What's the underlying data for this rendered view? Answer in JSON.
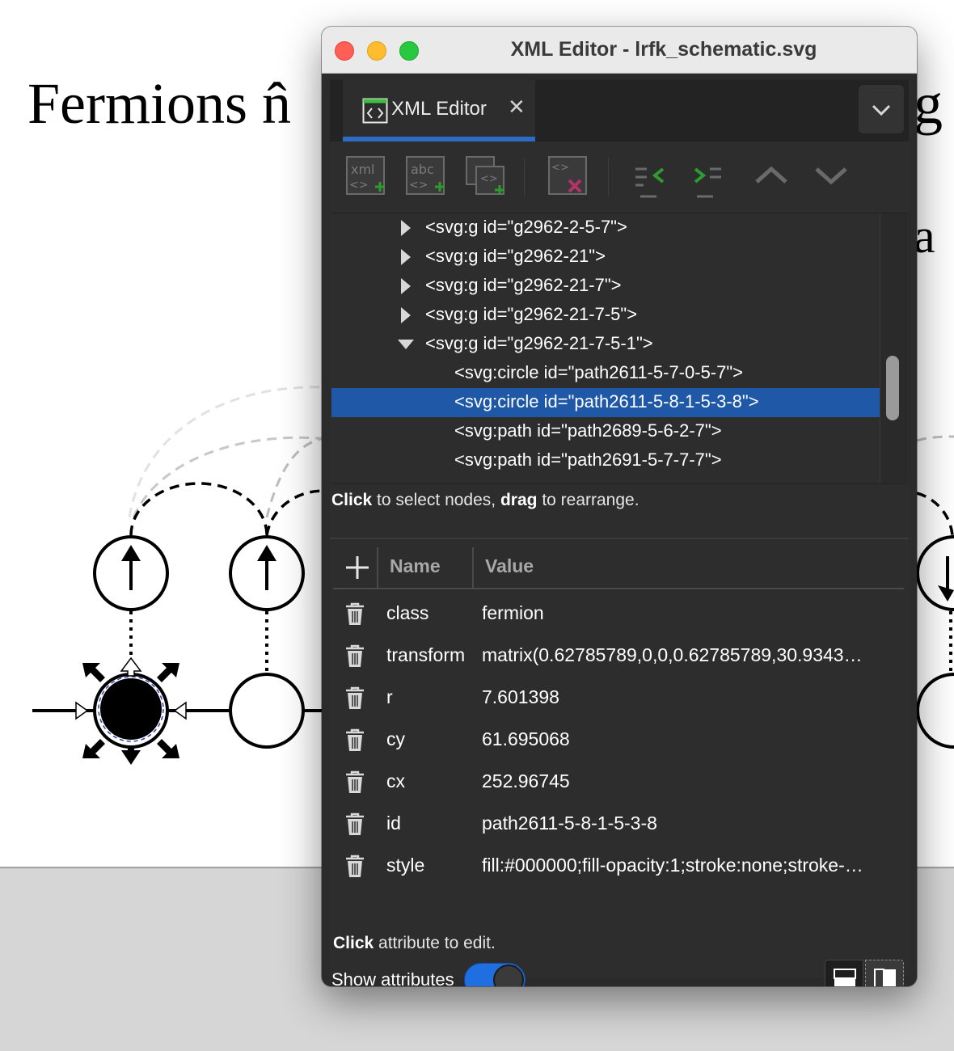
{
  "canvas": {
    "heading_left": "Fermions n̂",
    "heading_right": "g",
    "heading_right2": "a"
  },
  "window": {
    "title": "XML Editor - lrfk_schematic.svg"
  },
  "tab": {
    "label": "XML Editor",
    "close_glyph": "✕",
    "menu_icon": "chevron-down-icon"
  },
  "toolbar": {
    "new_element_icon": "xml-new-element-icon",
    "new_text_icon": "abc-new-text-node-icon",
    "duplicate_icon": "duplicate-node-icon",
    "delete_icon": "delete-node-icon",
    "unindent_icon": "unindent-node-icon",
    "indent_icon": "indent-node-icon",
    "raise_icon": "raise-node-icon",
    "lower_icon": "lower-node-icon"
  },
  "tree": {
    "nodes": [
      {
        "text": "<svg:g id=\"g2962-2-5-7\">",
        "expander": "collapsed"
      },
      {
        "text": "<svg:g id=\"g2962-21\">",
        "expander": "collapsed"
      },
      {
        "text": "<svg:g id=\"g2962-21-7\">",
        "expander": "collapsed"
      },
      {
        "text": "<svg:g id=\"g2962-21-7-5\">",
        "expander": "collapsed"
      },
      {
        "text": "<svg:g id=\"g2962-21-7-5-1\">",
        "expander": "expanded"
      },
      {
        "text": "<svg:circle id=\"path2611-5-7-0-5-7\">",
        "expander": "none"
      },
      {
        "text": "<svg:circle id=\"path2611-5-8-1-5-3-8\">",
        "expander": "none",
        "selected": true
      },
      {
        "text": "<svg:path id=\"path2689-5-6-2-7\">",
        "expander": "none"
      },
      {
        "text": "<svg:path id=\"path2691-5-7-7-7\">",
        "expander": "none"
      }
    ],
    "hint_bold_1": "Click",
    "hint_text_1": " to select nodes, ",
    "hint_bold_2": "drag",
    "hint_text_2": " to rearrange."
  },
  "attributes": {
    "header_name": "Name",
    "header_value": "Value",
    "rows": [
      {
        "name": "class",
        "value": "fermion"
      },
      {
        "name": "transform",
        "value": "matrix(0.62785789,0,0,0.62785789,30.9343…"
      },
      {
        "name": "r",
        "value": "7.601398"
      },
      {
        "name": "cy",
        "value": "61.695068"
      },
      {
        "name": "cx",
        "value": "252.96745"
      },
      {
        "name": "id",
        "value": "path2611-5-8-1-5-3-8"
      },
      {
        "name": "style",
        "value": "fill:#000000;fill-opacity:1;stroke:none;stroke-…"
      }
    ],
    "hint_bold": "Click",
    "hint_text": " attribute to edit.",
    "show_attributes_label": "Show attributes",
    "show_attributes_on": true
  },
  "colors": {
    "selection": "#1f58a6",
    "toggle_on": "#1f6fe0",
    "panel_bg": "#2d2d2d"
  }
}
